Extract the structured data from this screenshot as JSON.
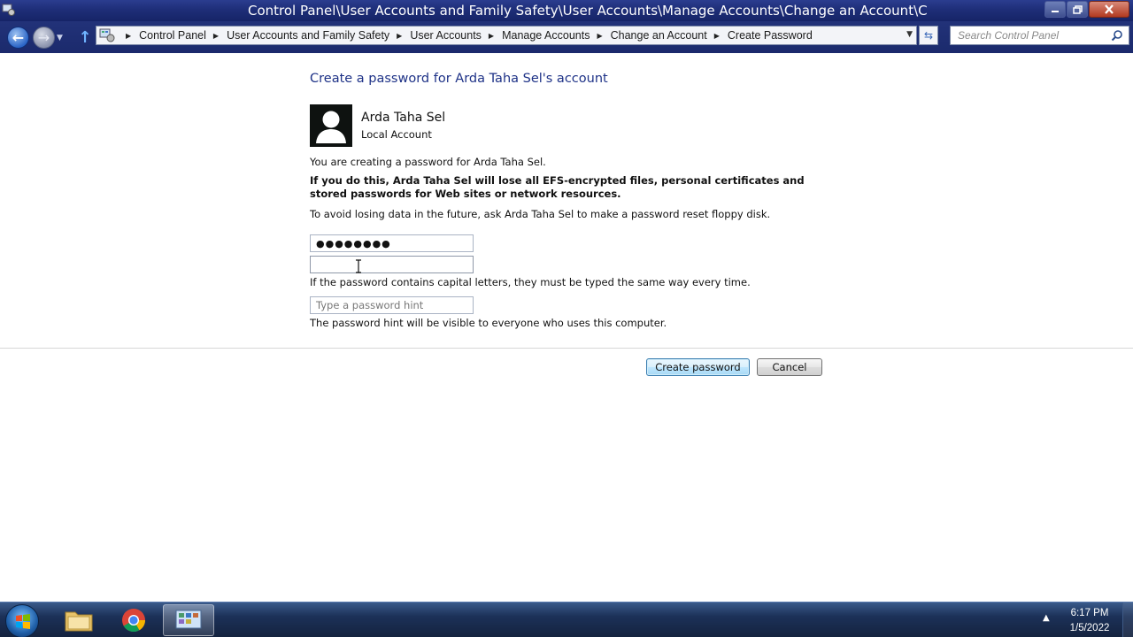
{
  "window": {
    "title": "Control Panel\\User Accounts and Family Safety\\User Accounts\\Manage Accounts\\Change an Account\\C"
  },
  "nav": {
    "breadcrumbs": [
      "Control Panel",
      "User Accounts and Family Safety",
      "User Accounts",
      "Manage Accounts",
      "Change an Account",
      "Create Password"
    ],
    "search_placeholder": "Search Control Panel"
  },
  "main": {
    "title": "Create a password for Arda Taha Sel's account",
    "account_name": "Arda Taha Sel",
    "account_type": "Local Account",
    "info_line": "You are creating a password for Arda Taha Sel.",
    "warning": "If you do this, Arda Taha Sel will lose all EFS-encrypted files, personal certificates and stored passwords for Web sites or network resources.",
    "reset_tip": "To avoid losing data in the future, ask Arda Taha Sel to make a password reset floppy disk.",
    "password_value": "●●●●●●●●",
    "confirm_value": "",
    "capital_note": "If the password contains capital letters, they must be typed the same way every time.",
    "hint_placeholder": "Type a password hint",
    "hint_note": "The password hint will be visible to everyone who uses this computer."
  },
  "buttons": {
    "create": "Create password",
    "cancel": "Cancel"
  },
  "taskbar": {
    "time": "6:17 PM",
    "date": "1/5/2022",
    "items": [
      "windows-explorer",
      "google-chrome",
      "control-panel"
    ]
  }
}
